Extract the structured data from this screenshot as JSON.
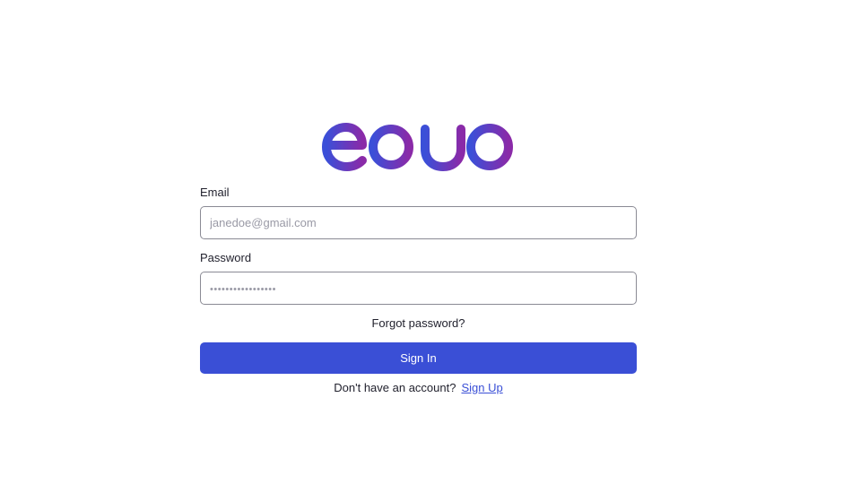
{
  "brand": {
    "logo_text": "eduo",
    "gradient_start": "#3b4fd8",
    "gradient_end": "#8a2aa8"
  },
  "form": {
    "email_label": "Email",
    "email_placeholder": "janedoe@gmail.com",
    "password_label": "Password",
    "password_placeholder": "•••••••••••••••••",
    "forgot_password": "Forgot password?",
    "sign_in_label": "Sign In",
    "no_account_text": "Don't have an account?",
    "sign_up_label": "Sign Up"
  },
  "colors": {
    "accent": "#3a4fd6"
  }
}
